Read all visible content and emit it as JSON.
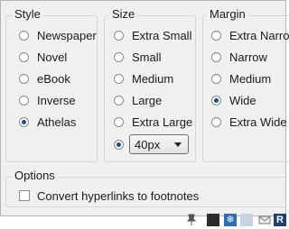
{
  "style": {
    "title": "Style",
    "options": [
      {
        "label": "Newspaper",
        "selected": false
      },
      {
        "label": "Novel",
        "selected": false
      },
      {
        "label": "eBook",
        "selected": false
      },
      {
        "label": "Inverse",
        "selected": false
      },
      {
        "label": "Athelas",
        "selected": true
      }
    ]
  },
  "size": {
    "title": "Size",
    "options": [
      {
        "label": "Extra Small",
        "selected": false
      },
      {
        "label": "Small",
        "selected": false
      },
      {
        "label": "Medium",
        "selected": false
      },
      {
        "label": "Large",
        "selected": false
      },
      {
        "label": "Extra Large",
        "selected": false
      }
    ],
    "custom_selected": true,
    "custom_value": "40px"
  },
  "margin": {
    "title": "Margin",
    "options": [
      {
        "label": "Extra Narrow",
        "selected": false
      },
      {
        "label": "Narrow",
        "selected": false
      },
      {
        "label": "Medium",
        "selected": false
      },
      {
        "label": "Wide",
        "selected": true
      },
      {
        "label": "Extra Wide",
        "selected": false
      }
    ]
  },
  "options": {
    "title": "Options",
    "checkbox_label": "Convert hyperlinks to footnotes",
    "checked": false
  },
  "colors": {
    "radio_dot": "#1f4f82",
    "panel_bg": "#f0f0f0"
  }
}
